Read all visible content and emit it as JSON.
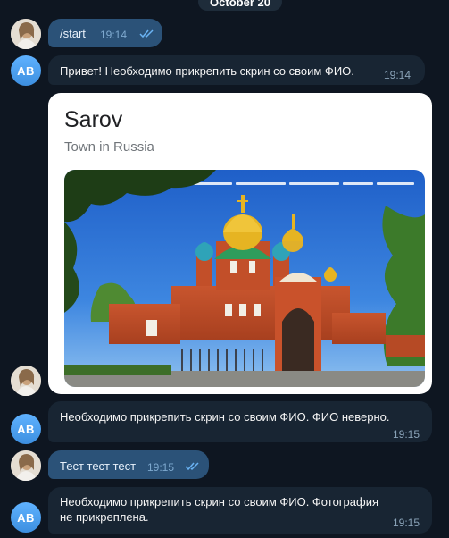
{
  "date_divider": "October 20",
  "messages": [
    {
      "text": "/start",
      "time": "19:14"
    },
    {
      "text": "Привет! Необходимо прикрепить скрин со своим ФИО.",
      "time": "19:14",
      "avatar": "AB"
    },
    {
      "card_title": "Sarov",
      "card_subtitle": "Town in Russia"
    },
    {
      "text": "Необходимо прикрепить скрин со своим ФИО.  ФИО неверно.",
      "time": "19:15",
      "avatar": "AB"
    },
    {
      "text": "Тест тест тест",
      "time": "19:15"
    },
    {
      "text": "Необходимо прикрепить скрин со своим ФИО.  Фотография не прикреплена.",
      "time": "19:15",
      "avatar": "AB"
    }
  ],
  "colors": {
    "background": "#0e1621",
    "outgoing_bubble": "#2b5278",
    "incoming_bubble": "#182533",
    "avatar_bot": "#4a9de8",
    "read_ticks": "#6ab3f3"
  },
  "icons": [
    "user-photo-avatar",
    "double-check-read-icon"
  ]
}
